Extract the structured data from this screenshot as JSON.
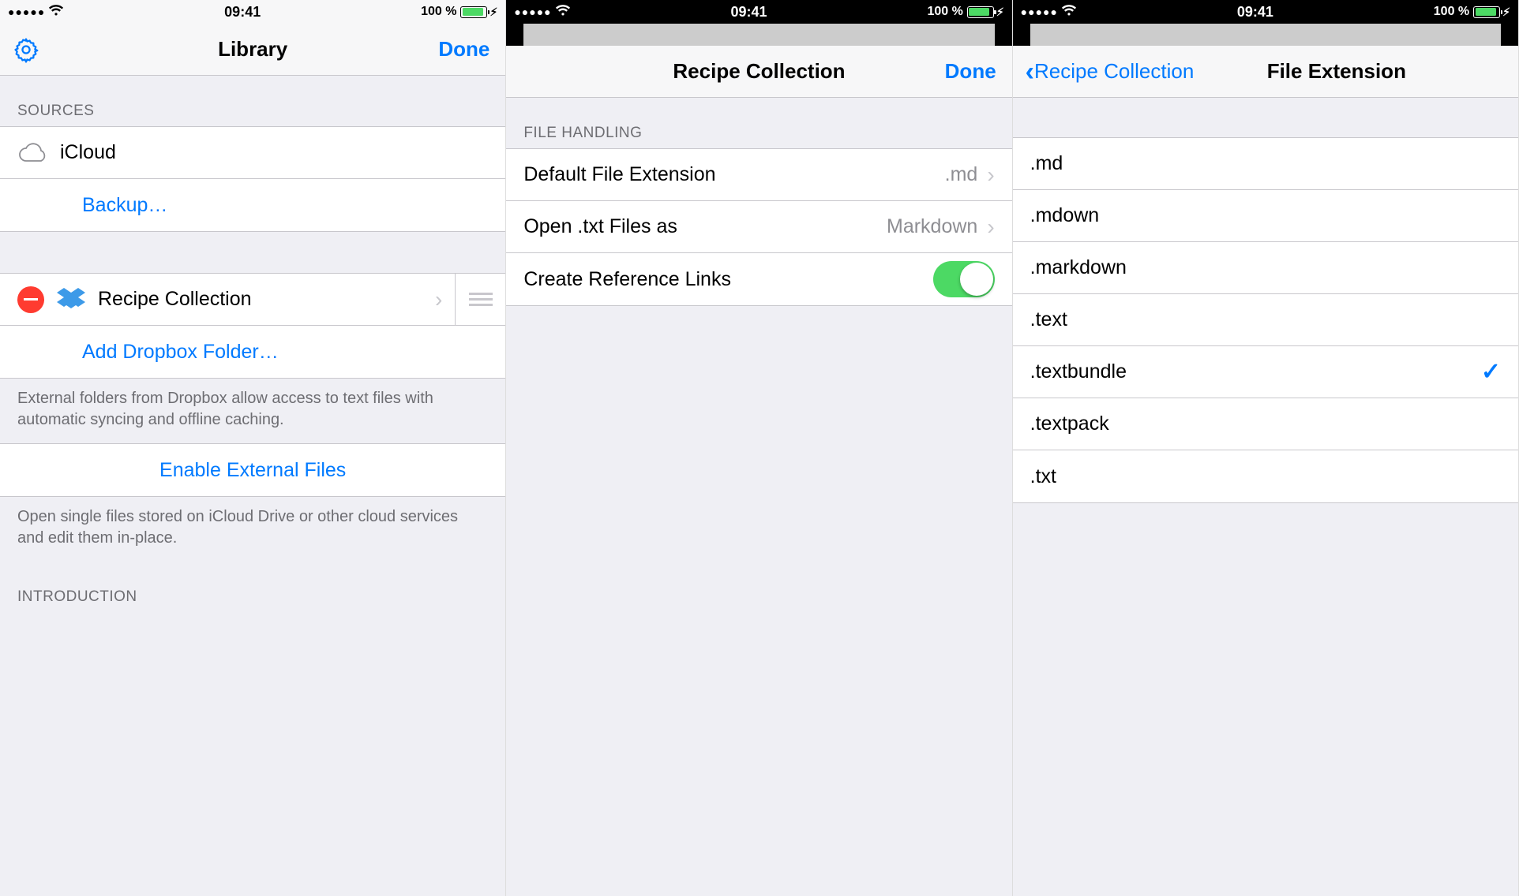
{
  "status": {
    "time": "09:41",
    "battery_text": "100 %",
    "signal": "●●●●●"
  },
  "screen1": {
    "nav_title": "Library",
    "done": "Done",
    "section_sources": "SOURCES",
    "icloud": "iCloud",
    "backup": "Backup…",
    "recipe_collection": "Recipe Collection",
    "add_dropbox": "Add Dropbox Folder…",
    "dropbox_footer": "External folders from Dropbox allow access to text files with automatic syncing and offline caching.",
    "enable_external": "Enable External Files",
    "external_footer": "Open single files stored on iCloud Drive or other cloud services and edit them in-place.",
    "section_intro": "INTRODUCTION"
  },
  "screen2": {
    "nav_title": "Recipe Collection",
    "done": "Done",
    "section_file_handling": "FILE HANDLING",
    "default_ext_label": "Default File Extension",
    "default_ext_value": ".md",
    "open_txt_label": "Open .txt Files as",
    "open_txt_value": "Markdown",
    "ref_links_label": "Create Reference Links",
    "ref_links_on": true
  },
  "screen3": {
    "nav_back": "Recipe Collection",
    "nav_title": "File Extension",
    "options": [
      {
        "label": ".md",
        "selected": false
      },
      {
        "label": ".mdown",
        "selected": false
      },
      {
        "label": ".markdown",
        "selected": false
      },
      {
        "label": ".text",
        "selected": false
      },
      {
        "label": ".textbundle",
        "selected": true
      },
      {
        "label": ".textpack",
        "selected": false
      },
      {
        "label": ".txt",
        "selected": false
      }
    ]
  }
}
